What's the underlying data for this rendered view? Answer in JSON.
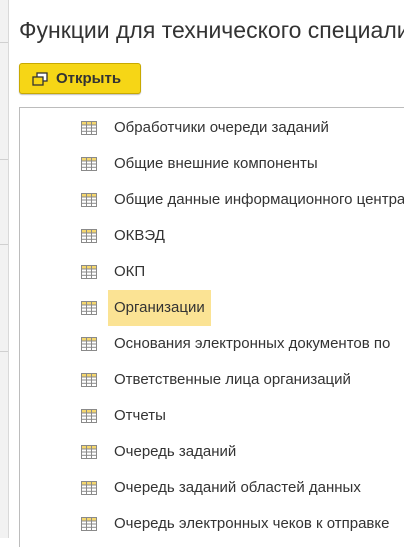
{
  "window": {
    "title": "Функции для технического специалиста"
  },
  "toolbar": {
    "open_label": "Открыть",
    "open_icon": "open-form-icon"
  },
  "list": {
    "item_icon": "table-icon",
    "selected_color": "#fbe394",
    "items": [
      {
        "label": "Обработчики очереди заданий"
      },
      {
        "label": "Общие внешние компоненты"
      },
      {
        "label": "Общие данные информационного центра"
      },
      {
        "label": "ОКВЭД"
      },
      {
        "label": "ОКП"
      },
      {
        "label": "Организации",
        "selected": true
      },
      {
        "label": "Основания электронных документов по"
      },
      {
        "label": "Ответственные лица организаций"
      },
      {
        "label": "Отчеты"
      },
      {
        "label": "Очередь заданий"
      },
      {
        "label": "Очередь заданий областей данных"
      },
      {
        "label": "Очередь электронных чеков к отправке"
      }
    ]
  },
  "colors": {
    "button_bg": "#f6d616",
    "icon_fill": "#f5d76e"
  }
}
